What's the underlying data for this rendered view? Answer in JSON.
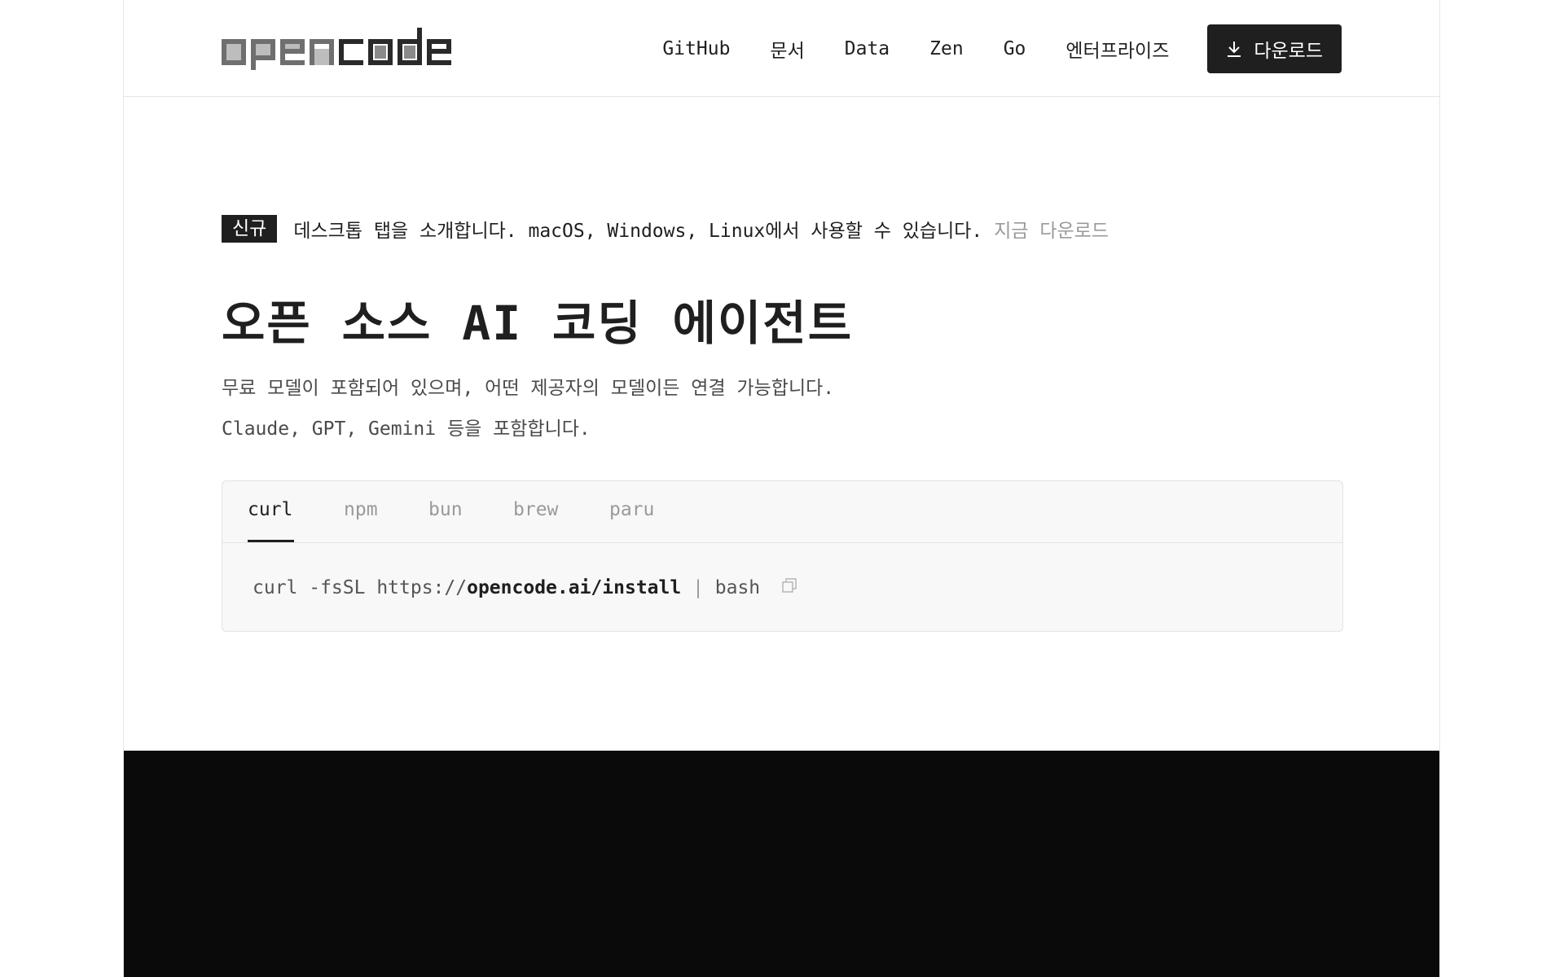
{
  "header": {
    "logo_text": "opencode",
    "nav": [
      {
        "label": "GitHub"
      },
      {
        "label": "문서"
      },
      {
        "label": "Data"
      },
      {
        "label": "Zen"
      },
      {
        "label": "Go"
      },
      {
        "label": "엔터프라이즈"
      }
    ],
    "download_label": "다운로드"
  },
  "announcement": {
    "badge": "신규",
    "text": "데스크톱 탭을 소개합니다. macOS, Windows, Linux에서 사용할 수 있습니다.",
    "link": "지금 다운로드"
  },
  "hero": {
    "title": "오픈 소스 AI 코딩 에이전트",
    "subtitle_line1": "무료 모델이 포함되어 있으며, 어떤 제공자의 모델이든 연결 가능합니다.",
    "subtitle_line2": "Claude, GPT, Gemini 등을 포함합니다."
  },
  "install": {
    "tabs": [
      {
        "label": "curl",
        "active": true
      },
      {
        "label": "npm",
        "active": false
      },
      {
        "label": "bun",
        "active": false
      },
      {
        "label": "brew",
        "active": false
      },
      {
        "label": "paru",
        "active": false
      }
    ],
    "command_prefix": "curl -fsSL https://",
    "command_strong": "opencode.ai/install",
    "command_pipe": " | ",
    "command_suffix": "bash"
  },
  "colors": {
    "text": "#1f1f1f",
    "muted": "#9a9a9a",
    "terminal_bg": "#0a0a0a",
    "button_bg": "#1f1f1f"
  },
  "icons": {
    "download": "download-icon",
    "copy": "copy-icon"
  }
}
